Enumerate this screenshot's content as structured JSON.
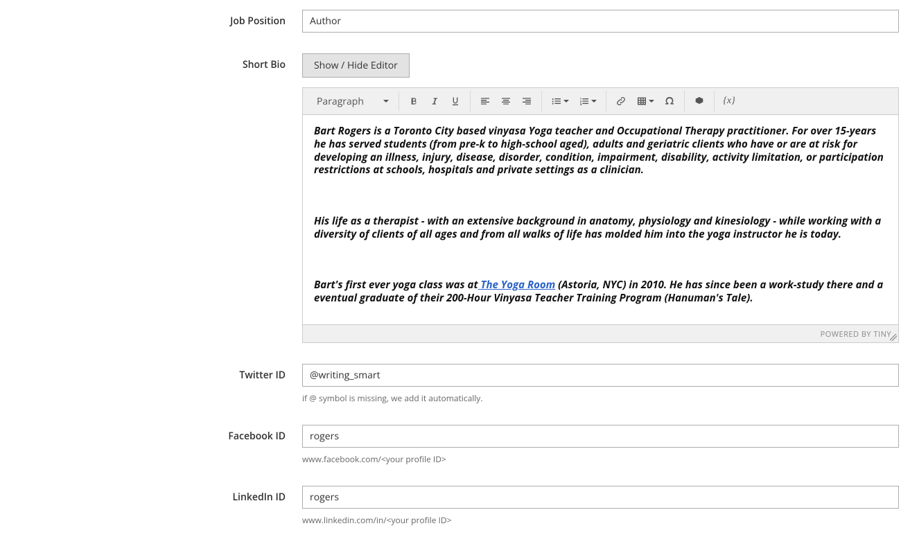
{
  "fields": {
    "job_position": {
      "label": "Job Position",
      "value": "Author"
    },
    "short_bio": {
      "label": "Short Bio",
      "toggle_button": "Show / Hide Editor"
    },
    "twitter": {
      "label": "Twitter ID",
      "value": "@writing_smart",
      "help": "if @ symbol is missing, we add it automatically."
    },
    "facebook": {
      "label": "Facebook ID",
      "value": "rogers",
      "help": "www.facebook.com/<your profile ID>"
    },
    "linkedin": {
      "label": "LinkedIn ID",
      "value": "rogers",
      "help": "www.linkedin.com/in/<your profile ID>"
    }
  },
  "editor": {
    "format_select": "Paragraph",
    "powered_by": "POWERED BY TINY",
    "paragraphs": {
      "p1": "Bart Rogers is a Toronto City based vinyasa Yoga teacher and Occupational Therapy practitioner. For over 15-years  he has served students (from pre-k to high-school aged), adults and geriatric clients who have or are at risk for developing an illness, injury, disease, disorder, condition, impairment, disability, activity limitation, or participation restrictions at schools, hospitals and private settings as a clinician.",
      "p2": "His life as a therapist - with an extensive background in anatomy, physiology and kinesiology - while working with a diversity of clients of all ages and from all walks of life has molded him into the yoga instructor he is today.",
      "p3a": "Bart's first ever yoga class was at",
      "p3_link": " The Yoga Room",
      "p3b": " (Astoria, NYC) in 2010. He has since been a work-study there and a eventual graduate of their  200-Hour Vinyasa Teacher Training Program (Hanuman's Tale)."
    }
  }
}
